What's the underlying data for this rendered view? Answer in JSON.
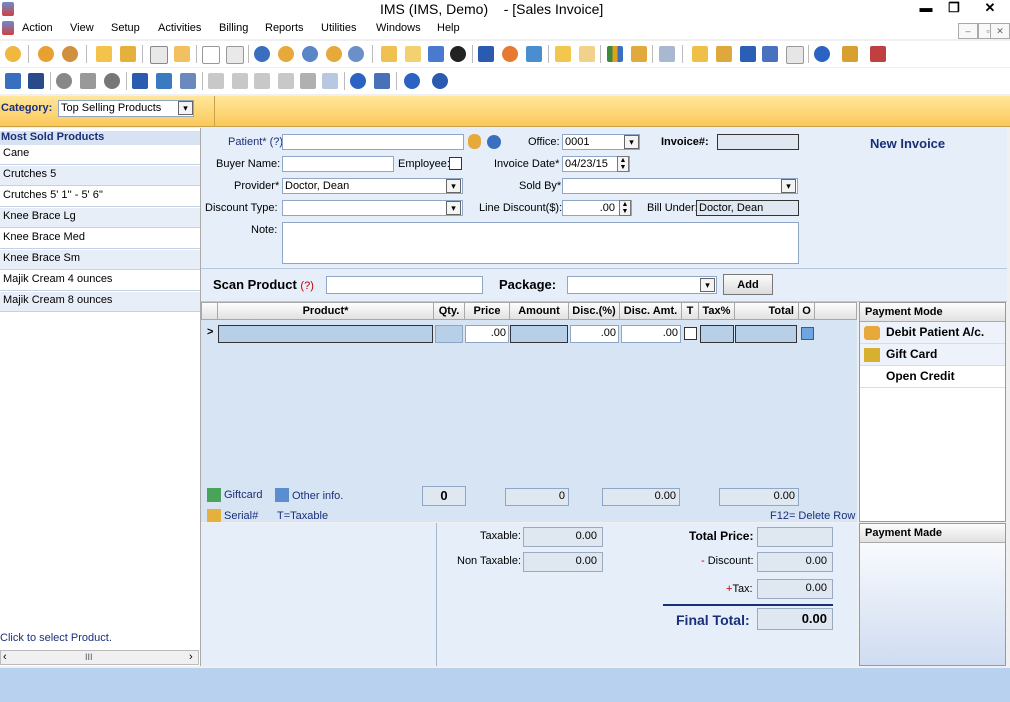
{
  "window": {
    "title": "IMS (IMS, Demo)",
    "doc_title": "- [Sales Invoice]",
    "minimize": "▬",
    "restore": "❐",
    "close": "✕"
  },
  "menu": [
    "Action",
    "View",
    "Setup",
    "Activities",
    "Billing",
    "Reports",
    "Utilities",
    "Windows",
    "Help"
  ],
  "category": {
    "label": "Category:",
    "value": "Top Selling Products"
  },
  "left_panel": {
    "header": "Most Sold Products",
    "items": [
      "Cane",
      "Crutches 5",
      "Crutches 5' 1'' - 5' 6''",
      "Knee Brace Lg",
      "Knee Brace Med",
      "Knee Brace Sm",
      "Majik Cream 4 ounces",
      "Majik Cream 8 ounces"
    ],
    "hint": "Click to select Product.",
    "scroll_thumb": "III"
  },
  "form": {
    "patient_label": "Patient* (?)",
    "patient_value": "",
    "office_label": "Office:",
    "office_value": "0001",
    "invoice_no_label": "Invoice#:",
    "invoice_no_value": "",
    "status": "New Invoice",
    "buyer_label": "Buyer Name:",
    "buyer_value": "",
    "employee_label": "Employee:",
    "invoice_date_label": "Invoice Date*",
    "invoice_date_value": "04/23/15",
    "provider_label": "Provider*",
    "provider_value": "Doctor, Dean",
    "sold_by_label": "Sold By*",
    "sold_by_value": "",
    "discount_type_label": "Discount Type:",
    "discount_type_value": "",
    "line_discount_label": "Line Discount($):",
    "line_discount_value": ".00",
    "bill_under_label": "Bill Under:",
    "bill_under_value": "Doctor, Dean",
    "note_label": "Note:",
    "note_value": ""
  },
  "scan": {
    "label": "Scan Product",
    "help": "(?)",
    "package_label": "Package:",
    "package_value": "",
    "add_label": "Add"
  },
  "grid": {
    "columns": [
      "Product*",
      "Qty.",
      "Price",
      "Amount",
      "Disc.(%)",
      "Disc. Amt.",
      "T",
      "Tax%",
      "Total",
      "O"
    ],
    "row": {
      "marker": ">",
      "price": ".00",
      "disc_pct": ".00",
      "disc_amt": ".00"
    },
    "giftcard_label": "Giftcard",
    "other_info_label": "Other info.",
    "serial_label": "Serial#",
    "taxable_legend": "T=Taxable",
    "qty_total": "0",
    "amount_total": "0",
    "disc_total": "0.00",
    "total_total": "0.00",
    "f12_hint": "F12= Delete Row"
  },
  "payment_mode": {
    "header": "Payment Mode",
    "items": [
      "Debit Patient A/c.",
      "Gift Card",
      "Open Credit"
    ]
  },
  "payment_made": {
    "header": "Payment Made"
  },
  "summary": {
    "taxable_label": "Taxable:",
    "taxable_value": "0.00",
    "non_taxable_label": "Non Taxable:",
    "non_taxable_value": "0.00",
    "total_price_label": "Total Price:",
    "total_price_value": "",
    "discount_label": "Discount:",
    "discount_sign": "-",
    "discount_value": "0.00",
    "tax_label": "Tax:",
    "tax_sign": "+",
    "tax_value": "0.00",
    "final_total_label": "Final Total:",
    "final_total_value": "0.00"
  },
  "colors": {
    "accent": "#fbc85a",
    "panel": "#e5eef9",
    "grid": "#d7e4f4",
    "label_blue": "#1a2f7a",
    "help_red": "#c00000"
  }
}
